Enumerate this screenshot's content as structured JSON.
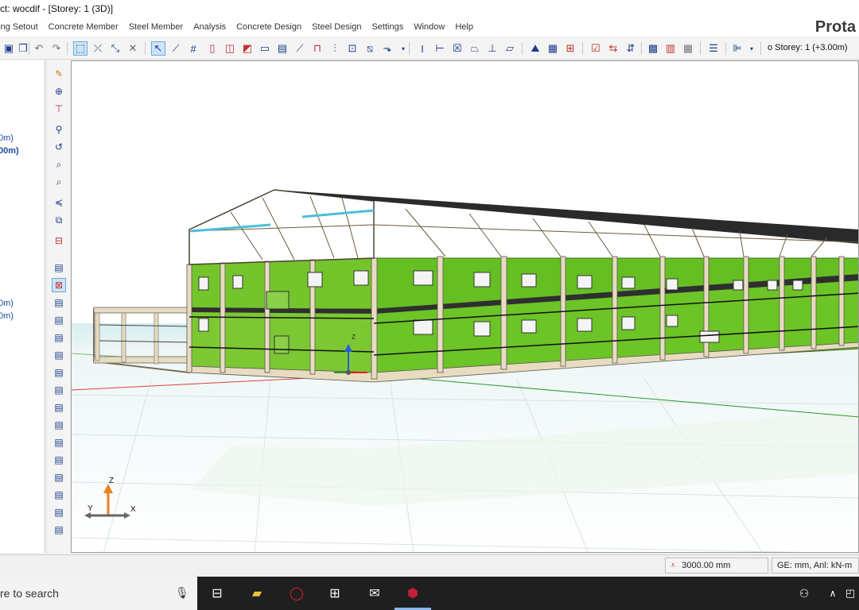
{
  "window": {
    "title": "ct: wocdif - [Storey: 1 (3D)]",
    "brand": "Prota"
  },
  "menu": [
    "ding Setout",
    "Concrete Member",
    "Steel Member",
    "Analysis",
    "Concrete Design",
    "Steel Design",
    "Settings",
    "Window",
    "Help"
  ],
  "toolbar": {
    "storey_label": "o  Storey: 1 (+3.00m)"
  },
  "left_panel": {
    "items": [
      "0m)",
      "00m)",
      "0m)",
      "0m)"
    ]
  },
  "viewport": {
    "view": "3D",
    "axis_triad": {
      "z": "Z",
      "y": "Y",
      "x": "X"
    },
    "model_axis": {
      "z": "Z"
    },
    "colors": {
      "wall_green": "#6cc426",
      "frame_beige": "#e8dcc0",
      "roof_dark": "#2f2f2f",
      "axis_red": "#e02020",
      "axis_green": "#2a9a2a",
      "axis_blue": "#2a5ad8",
      "axis_orange": "#e8821e"
    }
  },
  "status": {
    "elevation": "3000.00 mm",
    "units": "GE: mm,  Anl: kN-m"
  },
  "taskbar": {
    "search_placeholder": "re to search"
  }
}
